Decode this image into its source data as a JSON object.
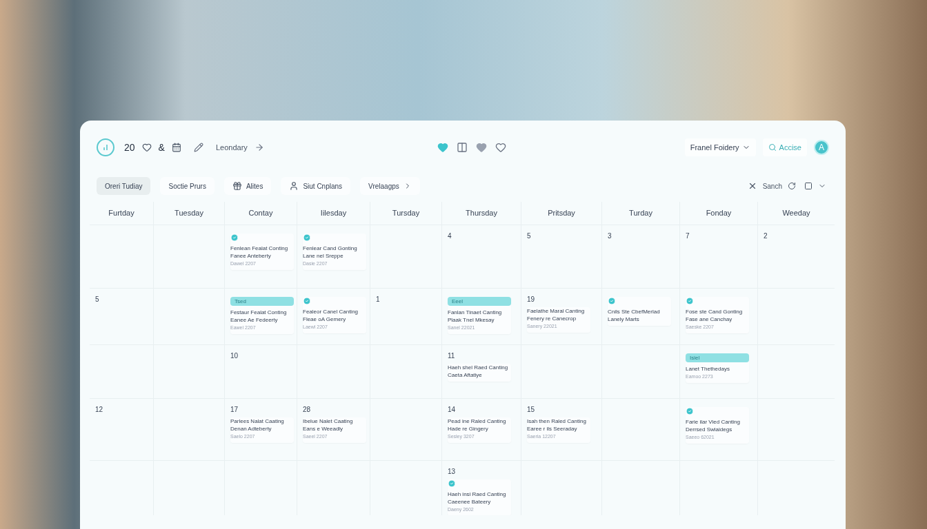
{
  "topbar": {
    "count": "20",
    "symbol": "&",
    "title": "Leondary",
    "center_icons": [
      {
        "kind": "heart",
        "on": true
      },
      {
        "kind": "columns",
        "on": false
      },
      {
        "kind": "heart",
        "on": false
      },
      {
        "kind": "heart-outline",
        "on": false
      }
    ],
    "workspace": "Franel Foidery",
    "search_button": "Accise",
    "avatar": "A"
  },
  "toolbar": {
    "filters": [
      {
        "label": "Oreri Tudiay",
        "kind": "plain",
        "selected": true
      },
      {
        "label": "Soctie Prurs",
        "kind": "plain",
        "selected": false
      },
      {
        "label": "Alites",
        "kind": "gift",
        "selected": false
      },
      {
        "label": "Siut Cnplans",
        "kind": "person",
        "selected": false
      },
      {
        "label": "Vrelaagps",
        "kind": "menu",
        "selected": false
      }
    ],
    "search": "Sanch"
  },
  "calendar": {
    "columns": [
      "Furtday",
      "Tuesday",
      "Contay",
      "Iilesday",
      "Tursday",
      "Thursday",
      "Pritsday",
      "Turday",
      "Fonday",
      "Weeday"
    ],
    "weeks": [
      {
        "cells": [
          {},
          {},
          {
            "events": [
              {
                "kind": "icon",
                "title": "Fenlean Fealat Conting",
                "subtitle": "Fanee Anteberty",
                "meta": "Dawel 2207"
              }
            ]
          },
          {
            "events": [
              {
                "kind": "icon",
                "title": "Fenlear Cand Gonting",
                "subtitle": "Lane nel Sreppe",
                "meta": "Dasie 2207"
              }
            ]
          },
          {},
          {
            "day": "4"
          },
          {
            "day": "5"
          },
          {
            "day": "3"
          },
          {
            "day": "7"
          },
          {
            "day": "2"
          }
        ]
      },
      {
        "cells": [
          {
            "day": "5"
          },
          {},
          {
            "events": [
              {
                "kind": "tag",
                "tag": "Tsed",
                "title": "Festaur Fealat Conting",
                "subtitle": "Eanee Ae Fedeerty",
                "meta": "Eawel 2207"
              }
            ]
          },
          {
            "events": [
              {
                "kind": "icon",
                "title": "Fealeor Canel Canting",
                "subtitle": "Fleae oA Gemery",
                "meta": "Laewl 2207"
              }
            ]
          },
          {
            "day": "1"
          },
          {
            "events": [
              {
                "kind": "tag",
                "tag": "Eeel",
                "title": "Fanlan Tinaet Canting",
                "subtitle": "Plaak Tnel Mkesay",
                "meta": "Sanel 22021"
              }
            ]
          },
          {
            "day": "19",
            "events": [
              {
                "kind": "plain",
                "title": "Faelathe Maral Canting",
                "subtitle": "Fenery re Canecrop",
                "meta": "Sanery 22021"
              }
            ]
          },
          {
            "events": [
              {
                "kind": "icon",
                "title": "Cnils Ste CbefMerlad",
                "subtitle": "Lanely Marts"
              }
            ]
          },
          {
            "events": [
              {
                "kind": "icon",
                "title": "Fose ste Cand Gonting",
                "subtitle": "Fase ane Canchay",
                "meta": "Saeske 2207"
              }
            ]
          },
          {}
        ]
      },
      {
        "cells": [
          {},
          {},
          {
            "day": "10"
          },
          {},
          {},
          {
            "day": "11",
            "events": [
              {
                "kind": "plain",
                "title": "Haeh shel Raed Canting",
                "subtitle": "Caeta Aftatiye"
              }
            ]
          },
          {},
          {},
          {
            "events": [
              {
                "kind": "tag",
                "tag": "Isiel",
                "title": "Lanet Thethedays",
                "meta": "Eamoo 2273"
              }
            ]
          },
          {}
        ]
      },
      {
        "cells": [
          {
            "day": "12"
          },
          {},
          {
            "day": "17",
            "events": [
              {
                "kind": "plain",
                "title": "Parlees Nalat Caating",
                "subtitle": "Denan Adteberty",
                "meta": "Saelo 2207"
              }
            ]
          },
          {
            "day": "28",
            "events": [
              {
                "kind": "plain",
                "title": "Ibelue Nalet Caating",
                "subtitle": "Eans e Weeadly",
                "meta": "Saeel 2207"
              }
            ]
          },
          {},
          {
            "day": "14",
            "events": [
              {
                "kind": "plain",
                "title": "Pead ine Raled Canting",
                "subtitle": "Hade re Gingery",
                "meta": "Sesley 3207"
              }
            ]
          },
          {
            "day": "15",
            "events": [
              {
                "kind": "plain",
                "title": "Isah then Raled Canting",
                "subtitle": "Earee r ils Seeraday",
                "meta": "Saeria 12207"
              }
            ]
          },
          {},
          {
            "events": [
              {
                "kind": "icon",
                "title": "Farie ilar Vied Canting",
                "subtitle": "Derrsed Swiaidegs",
                "meta": "Saeeo 62021"
              }
            ]
          },
          {}
        ]
      },
      {
        "cells": [
          {},
          {},
          {},
          {},
          {},
          {
            "day": "13",
            "events": [
              {
                "kind": "icon",
                "title": "Haeh insi Raed Canting",
                "subtitle": "Caeenee Bateery",
                "meta": "Daeny 2602"
              }
            ]
          },
          {},
          {},
          {},
          {}
        ]
      }
    ]
  }
}
